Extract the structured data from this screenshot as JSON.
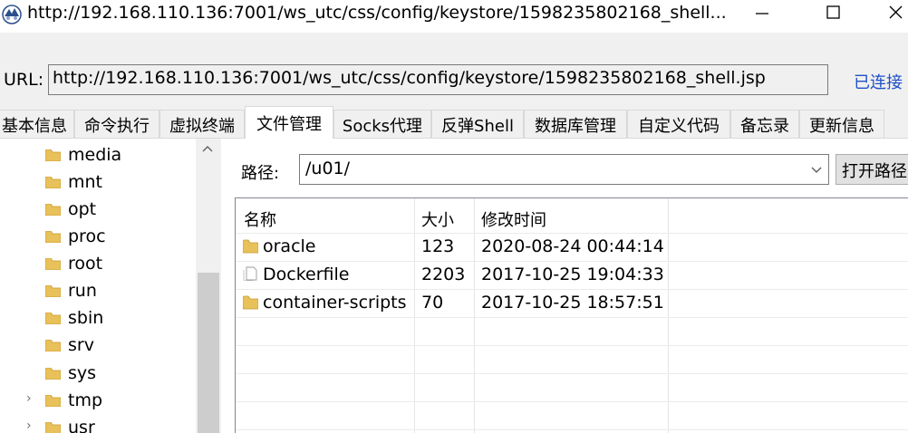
{
  "window": {
    "title": "http://192.168.110.136:7001/ws_utc/css/config/keystore/1598235802168_shell...",
    "minimize_glyph": "—",
    "maximize_glyph": "☐",
    "close_glyph": "✕",
    "app_icon": "app-logo-icon"
  },
  "urlbar": {
    "label": "URL:",
    "value": "http://192.168.110.136:7001/ws_utc/css/config/keystore/1598235802168_shell.jsp",
    "status": "已连接",
    "status_color": "#1e50c8"
  },
  "tabs": [
    {
      "label": "基本信息"
    },
    {
      "label": "命令执行"
    },
    {
      "label": "虚拟终端"
    },
    {
      "label": "文件管理",
      "active": true
    },
    {
      "label": "Socks代理"
    },
    {
      "label": "反弹Shell"
    },
    {
      "label": "数据库管理"
    },
    {
      "label": "自定义代码"
    },
    {
      "label": "备忘录"
    },
    {
      "label": "更新信息"
    }
  ],
  "tree": {
    "items": [
      {
        "label": "media",
        "expandable": false
      },
      {
        "label": "mnt",
        "expandable": false
      },
      {
        "label": "opt",
        "expandable": false
      },
      {
        "label": "proc",
        "expandable": false
      },
      {
        "label": "root",
        "expandable": false
      },
      {
        "label": "run",
        "expandable": false
      },
      {
        "label": "sbin",
        "expandable": false
      },
      {
        "label": "srv",
        "expandable": false
      },
      {
        "label": "sys",
        "expandable": false
      },
      {
        "label": "tmp",
        "expandable": true
      },
      {
        "label": "usr",
        "expandable": true
      }
    ],
    "expander_glyph": "›",
    "scroll_up_glyph": "^"
  },
  "path": {
    "label": "路径:",
    "value": "/u01/",
    "dropdown_glyph": "﹀",
    "open_button": "打开路径"
  },
  "file_table": {
    "columns": [
      "名称",
      "大小",
      "修改时间"
    ],
    "rows": [
      {
        "name": "oracle",
        "size": "123",
        "modified": "2020-08-24 00:44:14",
        "type": "folder"
      },
      {
        "name": "Dockerfile",
        "size": "2203",
        "modified": "2017-10-25 19:04:33",
        "type": "file"
      },
      {
        "name": "container-scripts",
        "size": "70",
        "modified": "2017-10-25 18:57:51",
        "type": "folder"
      }
    ]
  },
  "colors": {
    "folder": "#e8c15a",
    "folder_dark": "#c99a2e",
    "chrome_bg": "#f0f0f0"
  }
}
